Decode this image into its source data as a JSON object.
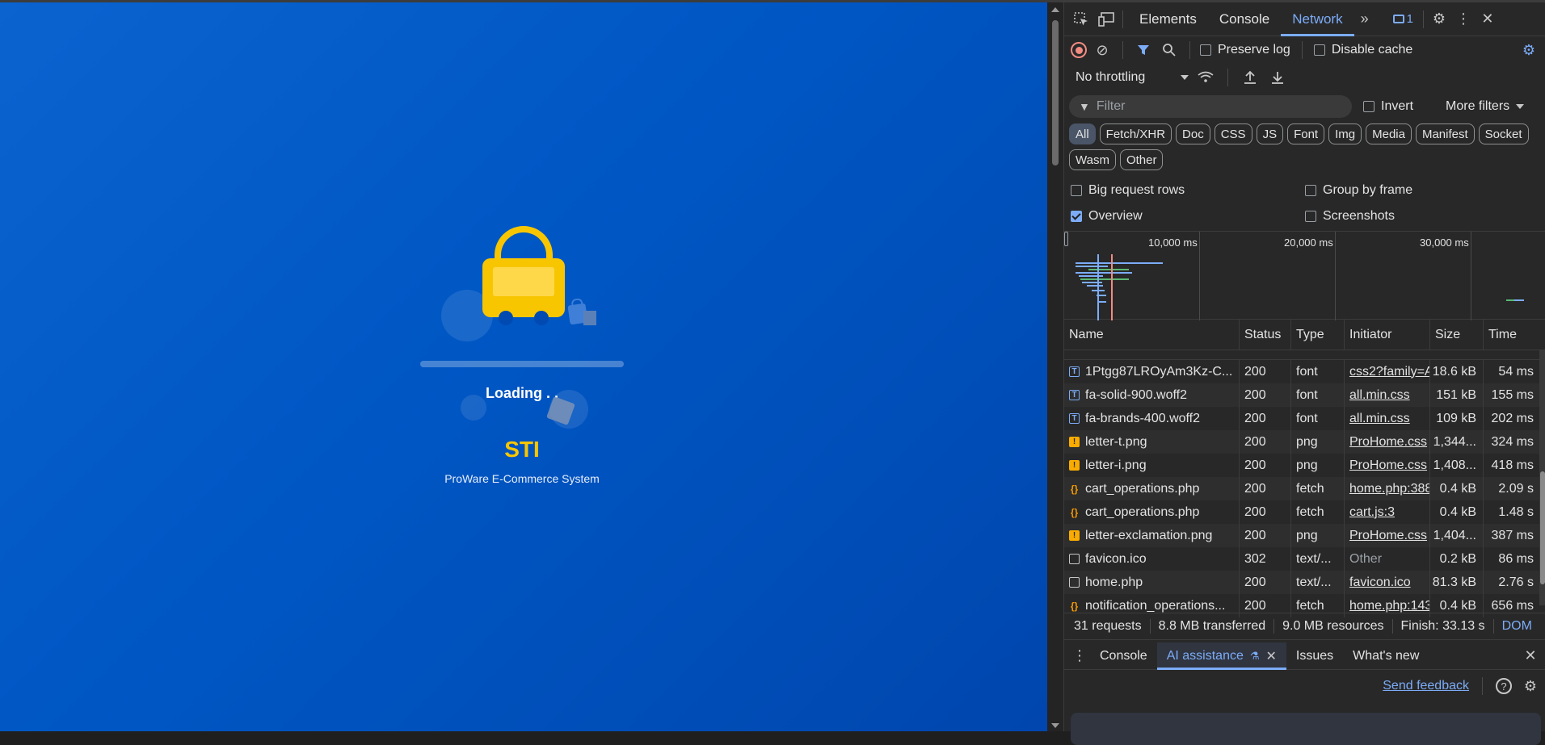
{
  "page": {
    "loading_text": "Loading . .",
    "brand": "STI",
    "tagline": "ProWare E-Commerce System"
  },
  "devtools": {
    "tabs": [
      "Elements",
      "Console",
      "Network"
    ],
    "active_tab": "Network",
    "more_tabs_icon": "»",
    "message_count": "1",
    "toolbar": {
      "preserve_log": "Preserve log",
      "disable_cache": "Disable cache",
      "throttling": "No throttling"
    },
    "filter": {
      "placeholder": "Filter",
      "invert": "Invert",
      "more_filters": "More filters"
    },
    "type_chips": [
      "All",
      "Fetch/XHR",
      "Doc",
      "CSS",
      "JS",
      "Font",
      "Img",
      "Media",
      "Manifest",
      "Socket",
      "Wasm",
      "Other"
    ],
    "active_chip": "All",
    "options": {
      "big_request_rows": "Big request rows",
      "group_by_frame": "Group by frame",
      "overview": "Overview",
      "screenshots": "Screenshots",
      "overview_checked": true
    },
    "overview_labels": [
      "10,000 ms",
      "20,000 ms",
      "30,000 ms"
    ],
    "columns": [
      "Name",
      "Status",
      "Type",
      "Initiator",
      "Size",
      "Time"
    ],
    "rows": [
      {
        "icon": "font",
        "name": "1Ptgg87LROyAm3Kz-C...",
        "status": "200",
        "type": "font",
        "initiator": "css2?family=A",
        "initiator_link": true,
        "size": "18.6 kB",
        "time": "54 ms"
      },
      {
        "icon": "font",
        "name": "fa-solid-900.woff2",
        "status": "200",
        "type": "font",
        "initiator": "all.min.css",
        "initiator_link": true,
        "size": "151 kB",
        "time": "155 ms"
      },
      {
        "icon": "font",
        "name": "fa-brands-400.woff2",
        "status": "200",
        "type": "font",
        "initiator": "all.min.css",
        "initiator_link": true,
        "size": "109 kB",
        "time": "202 ms"
      },
      {
        "icon": "img",
        "name": "letter-t.png",
        "status": "200",
        "type": "png",
        "initiator": "ProHome.css",
        "initiator_link": true,
        "size": "1,344...",
        "time": "324 ms"
      },
      {
        "icon": "img",
        "name": "letter-i.png",
        "status": "200",
        "type": "png",
        "initiator": "ProHome.css",
        "initiator_link": true,
        "size": "1,408...",
        "time": "418 ms"
      },
      {
        "icon": "fetch",
        "name": "cart_operations.php",
        "status": "200",
        "type": "fetch",
        "initiator": "home.php:388",
        "initiator_link": true,
        "size": "0.4 kB",
        "time": "2.09 s"
      },
      {
        "icon": "fetch",
        "name": "cart_operations.php",
        "status": "200",
        "type": "fetch",
        "initiator": "cart.js:3",
        "initiator_link": true,
        "size": "0.4 kB",
        "time": "1.48 s"
      },
      {
        "icon": "img",
        "name": "letter-exclamation.png",
        "status": "200",
        "type": "png",
        "initiator": "ProHome.css",
        "initiator_link": true,
        "size": "1,404...",
        "time": "387 ms"
      },
      {
        "icon": "doc",
        "name": "favicon.ico",
        "status": "302",
        "type": "text/...",
        "initiator": "Other",
        "initiator_link": false,
        "size": "0.2 kB",
        "time": "86 ms"
      },
      {
        "icon": "doc",
        "name": "home.php",
        "status": "200",
        "type": "text/...",
        "initiator": "favicon.ico",
        "initiator_link": true,
        "size": "81.3 kB",
        "time": "2.76 s"
      },
      {
        "icon": "fetch",
        "name": "notification_operations...",
        "status": "200",
        "type": "fetch",
        "initiator": "home.php:143",
        "initiator_link": true,
        "size": "0.4 kB",
        "time": "656 ms"
      }
    ],
    "status": {
      "requests": "31 requests",
      "transferred": "8.8 MB transferred",
      "resources": "9.0 MB resources",
      "finish": "Finish: 33.13 s",
      "dom": "DOM"
    },
    "drawer": {
      "tabs": [
        "Console",
        "AI assistance",
        "Issues",
        "What's new"
      ],
      "active_tab": "AI assistance",
      "send_feedback": "Send feedback"
    },
    "colors": {
      "accent": "#7cacf8",
      "record": "#f28b82",
      "brand_yellow": "#f7c600",
      "page_blue": "#0057c4"
    }
  }
}
